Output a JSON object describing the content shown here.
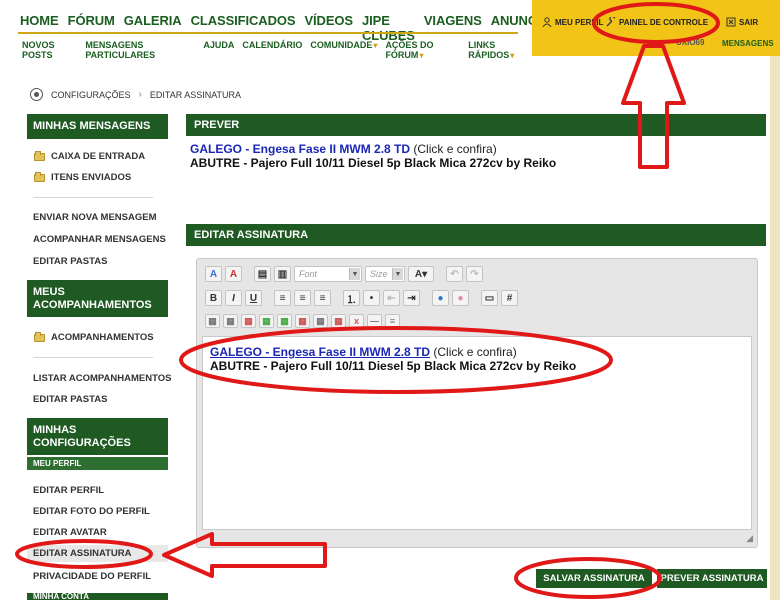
{
  "main_nav": [
    "HOME",
    "FÓRUM",
    "GALERIA",
    "CLASSIFICADOS",
    "VÍDEOS",
    "JIPE CLUBES",
    "VIAGENS",
    "ANUNCIE"
  ],
  "sub_nav": [
    "NOVOS POSTS",
    "MENSAGENS PARTICULARES",
    "AJUDA",
    "CALENDÁRIO",
    "COMUNIDADE",
    "AÇÕES DO FÓRUM",
    "LINKS RÁPIDOS"
  ],
  "user_bar": {
    "profile_label": "MEU PERFIL",
    "control_panel_label": "PAINEL DE CONTROLE",
    "logout_label": "SAIR",
    "username": "UXIO69",
    "messages_label": "MENSAGENS"
  },
  "breadcrumb": {
    "items": [
      "CONFIGURAÇÕES",
      "EDITAR ASSINATURA"
    ]
  },
  "sidebar": {
    "messages_header": "MINHAS MENSAGENS",
    "folders": [
      "CAIXA DE ENTRADA",
      "ITENS ENVIADOS"
    ],
    "message_links": [
      "ENVIAR NOVA MENSAGEM",
      "ACOMPANHAR MENSAGENS",
      "EDITAR PASTAS"
    ],
    "subscriptions_header_1": "MEUS",
    "subscriptions_header_2": "ACOMPANHAMENTOS",
    "subscription_folder": "ACOMPANHAMENTOS",
    "subscription_links": [
      "LISTAR ACOMPANHAMENTOS",
      "EDITAR PASTAS"
    ],
    "settings_header_1": "MINHAS",
    "settings_header_2": "CONFIGURAÇÕES",
    "settings_sub": "MEU PERFIL",
    "settings_links": [
      "EDITAR PERFIL",
      "EDITAR FOTO DO PERFIL",
      "EDITAR AVATAR",
      "EDITAR ASSINATURA",
      "PRIVACIDADE DO PERFIL"
    ],
    "cut_header": "MINHA CONTA"
  },
  "preview": {
    "header": "PREVER",
    "link_text": "GALEGO - Engesa Fase II MWM 2.8 TD",
    "after_link": " (Click e confira)",
    "line2": "ABUTRE - Pajero Full 10/11 Diesel 5p Black Mica 272cv by Reiko"
  },
  "editor": {
    "header": "EDITAR ASSINATURA",
    "font_placeholder": "Font",
    "size_placeholder": "Size",
    "link_text": "GALEGO - Engesa Fase II MWM 2.8 TD",
    "after_link": " (Click e confira)",
    "line2": "ABUTRE - Pajero Full 10/11 Diesel 5p Black Mica 272cv by Reiko"
  },
  "buttons": {
    "save": "SALVAR ASSINATURA",
    "preview": "PREVER ASSINATURA"
  },
  "colors": {
    "brand_green": "#1e5a22",
    "accent_yellow": "#f1c417",
    "link_blue": "#1a27b5",
    "annotation_red": "#e01818"
  }
}
